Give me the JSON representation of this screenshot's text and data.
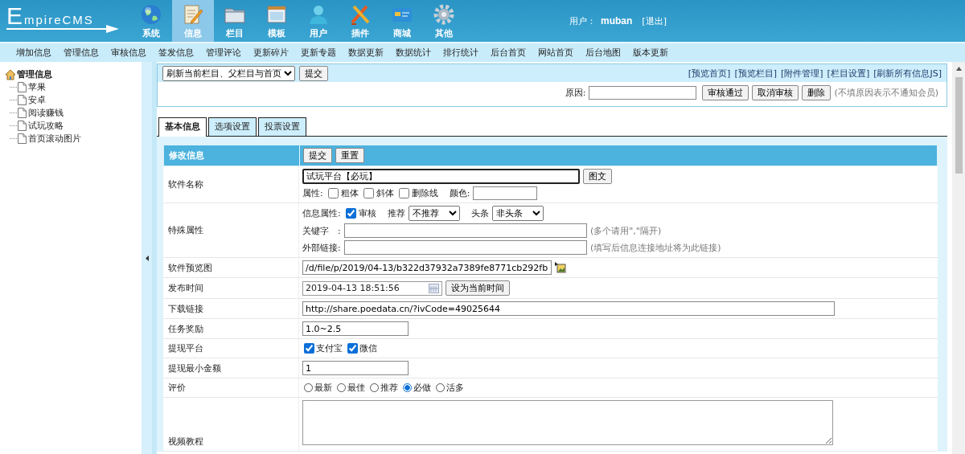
{
  "header": {
    "logo": "EmpireCMS",
    "nav": [
      {
        "label": "系统",
        "selected": false
      },
      {
        "label": "信息",
        "selected": true
      },
      {
        "label": "栏目",
        "selected": false
      },
      {
        "label": "模板",
        "selected": false
      },
      {
        "label": "用户",
        "selected": false
      },
      {
        "label": "插件",
        "selected": false
      },
      {
        "label": "商城",
        "selected": false
      },
      {
        "label": "其他",
        "selected": false
      }
    ],
    "user_label": "用户：",
    "user_name": "muban",
    "logout": "[退出]"
  },
  "subnav": [
    "增加信息",
    "管理信息",
    "审核信息",
    "签发信息",
    "管理评论",
    "更新碎片",
    "更新专题",
    "数据更新",
    "数据统计",
    "排行统计",
    "后台首页",
    "网站首页",
    "后台地图",
    "版本更新"
  ],
  "sidebar": {
    "root": "管理信息",
    "children": [
      {
        "label": "苹果"
      },
      {
        "label": "安卓"
      },
      {
        "label": "阅读赚钱"
      },
      {
        "label": "试玩攻略"
      },
      {
        "label": "首页滚动图片"
      }
    ]
  },
  "toolbar": {
    "refresh_select": "刷新当前栏目、父栏目与首页",
    "submit": "提交",
    "links": [
      "[预览首页]",
      "[预览栏目]",
      "[附件管理]",
      "[栏目设置]",
      "[刷新所有信息JS]"
    ],
    "reason_label": "原因:",
    "buttons": [
      "审核通过",
      "取消审核",
      "删除"
    ],
    "hint": "(不填原因表示不通知会员)"
  },
  "tabs": [
    {
      "label": "基本信息",
      "selected": true
    },
    {
      "label": "选项设置",
      "selected": false
    },
    {
      "label": "投票设置",
      "selected": false
    }
  ],
  "form": {
    "title": "修改信息",
    "buttons": [
      "提交",
      "重置"
    ],
    "rows": [
      {
        "kind": "title",
        "label": "软件名称",
        "value": "试玩平台【必玩】",
        "button": "图文",
        "attr_label": "属性:",
        "options": [
          {
            "label": "粗体",
            "checked": false
          },
          {
            "label": "斜体",
            "checked": false
          },
          {
            "label": "删除线",
            "checked": false
          }
        ],
        "color_label": "颜色:"
      },
      {
        "kind": "special",
        "label": "特殊属性",
        "info_label": "信息属性:",
        "review": {
          "label": "审核",
          "checked": true
        },
        "recommend_label": "推荐",
        "recommend_value": "不推荐",
        "headline_label": "头条",
        "headline_value": "非头条",
        "keyword_label": "关键字　:",
        "keyword_hint": "(多个请用\",\"隔开)",
        "link_label": "外部链接:",
        "link_hint": "(填写后信息连接地址将为此链接)"
      },
      {
        "kind": "image",
        "label": "软件预览图",
        "value": "/d/file/p/2019/04-13/b322d37932a7389fe8771cb292fb"
      },
      {
        "kind": "datetime",
        "label": "发布时间",
        "value": "2019-04-13 18:51:56",
        "button": "设为当前时间"
      },
      {
        "kind": "long_text",
        "label": "下载链接",
        "value": "http://share.poedata.cn/?ivCode=49025644"
      },
      {
        "kind": "text",
        "label": "任务奖励",
        "value": "1.0~2.5"
      },
      {
        "kind": "checkboxes",
        "label": "提现平台",
        "options": [
          {
            "label": "支付宝",
            "checked": true
          },
          {
            "label": "微信",
            "checked": true
          }
        ]
      },
      {
        "kind": "text",
        "label": "提现最小金额",
        "value": "1"
      },
      {
        "kind": "radios",
        "label": "评价",
        "options": [
          {
            "label": "最新",
            "selected": false
          },
          {
            "label": "最佳",
            "selected": false
          },
          {
            "label": "推荐",
            "selected": false
          },
          {
            "label": "必做",
            "selected": true
          },
          {
            "label": "活多",
            "selected": false
          }
        ]
      },
      {
        "kind": "textarea",
        "label": "视频教程"
      }
    ]
  }
}
